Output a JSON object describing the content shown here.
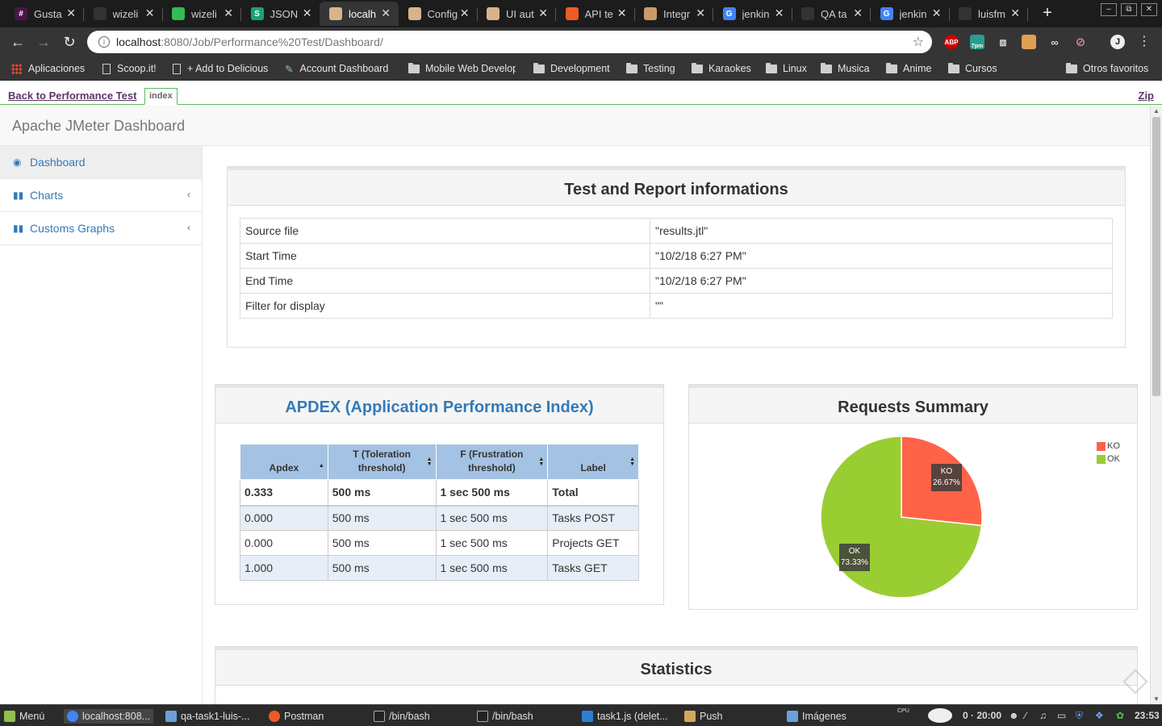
{
  "browser": {
    "tabs": [
      {
        "label": "Gusta",
        "favicon_color": "#4a154b",
        "favicon_glyph": "#"
      },
      {
        "label": "wizeli",
        "favicon_color": "#333333",
        "favicon_glyph": ""
      },
      {
        "label": "wizeli",
        "favicon_color": "#3b5",
        "favicon_glyph": ""
      },
      {
        "label": "JSON S",
        "favicon_color": "#1ca36e",
        "favicon_glyph": "S"
      },
      {
        "label": "localh",
        "favicon_color": "#d9b38c",
        "favicon_glyph": ""
      },
      {
        "label": "Config",
        "favicon_color": "#d9b38c",
        "favicon_glyph": ""
      },
      {
        "label": "UI aut",
        "favicon_color": "#d9b38c",
        "favicon_glyph": ""
      },
      {
        "label": "API te",
        "favicon_color": "#ef5b25",
        "favicon_glyph": ""
      },
      {
        "label": "Integr",
        "favicon_color": "#c96",
        "favicon_glyph": ""
      },
      {
        "label": "jenkin",
        "favicon_color": "#4285f4",
        "favicon_glyph": "G"
      },
      {
        "label": "QA ta",
        "favicon_color": "#333333",
        "favicon_glyph": ""
      },
      {
        "label": "jenkin",
        "favicon_color": "#4285f4",
        "favicon_glyph": "G"
      },
      {
        "label": "luisfm",
        "favicon_color": "#333333",
        "favicon_glyph": ""
      }
    ],
    "active_tab_index": 4,
    "url_host": "localhost",
    "url_path": ":8080/Job/Performance%20Test/Dashboard/",
    "extensions": [
      "ABP",
      "7pm"
    ],
    "bookmarks": [
      {
        "label": "Aplicaciones",
        "icon": "apps-grid-icon"
      },
      {
        "label": "Scoop.it!",
        "icon": "page-icon"
      },
      {
        "label": "+ Add to Delicious",
        "icon": "page-icon"
      },
      {
        "label": "Account Dashboard",
        "icon": "dashboard-icon"
      },
      {
        "label": "Mobile Web Develop",
        "icon": "folder-icon"
      },
      {
        "label": "Development",
        "icon": "folder-icon"
      },
      {
        "label": "Testing",
        "icon": "folder-icon"
      },
      {
        "label": "Karaokes",
        "icon": "folder-icon"
      },
      {
        "label": "Linux",
        "icon": "folder-icon"
      },
      {
        "label": "Musica",
        "icon": "folder-icon"
      },
      {
        "label": "Anime",
        "icon": "folder-icon"
      },
      {
        "label": "Cursos",
        "icon": "folder-icon"
      },
      {
        "label": "Otros favoritos",
        "icon": "folder-icon"
      }
    ]
  },
  "jenkins": {
    "back_label": "Back to Performance Test",
    "index_tab": "index",
    "zip_label": "Zip"
  },
  "dashboard": {
    "brand": "Apache JMeter Dashboard",
    "sidebar": [
      {
        "label": "Dashboard",
        "icon": "dashboard-icon",
        "active": true
      },
      {
        "label": "Charts",
        "icon": "bar-chart-icon",
        "active": false
      },
      {
        "label": "Customs Graphs",
        "icon": "bar-chart-icon",
        "active": false
      }
    ],
    "info_panel": {
      "title": "Test and Report informations",
      "rows": [
        {
          "key": "Source file",
          "value": "\"results.jtl\""
        },
        {
          "key": "Start Time",
          "value": "\"10/2/18 6:27 PM\""
        },
        {
          "key": "End Time",
          "value": "\"10/2/18 6:27 PM\""
        },
        {
          "key": "Filter for display",
          "value": "\"\""
        }
      ]
    },
    "apdex_panel": {
      "title": "APDEX (Application Performance Index)",
      "headers": [
        "Apdex",
        "T (Toleration threshold)",
        "F (Frustration threshold)",
        "Label"
      ],
      "header_lines": [
        [
          "Apdex"
        ],
        [
          "T (Toleration",
          "threshold)"
        ],
        [
          "F (Frustration",
          "threshold)"
        ],
        [
          "Label"
        ]
      ],
      "total": [
        "0.333",
        "500 ms",
        "1 sec 500 ms",
        "Total"
      ],
      "rows": [
        [
          "0.000",
          "500 ms",
          "1 sec 500 ms",
          "Tasks POST"
        ],
        [
          "0.000",
          "500 ms",
          "1 sec 500 ms",
          "Projects GET"
        ],
        [
          "1.000",
          "500 ms",
          "1 sec 500 ms",
          "Tasks GET"
        ]
      ]
    },
    "requests_panel": {
      "title": "Requests Summary"
    },
    "statistics_title": "Statistics"
  },
  "chart_data": {
    "type": "pie",
    "title": "Requests Summary",
    "categories": [
      "KO",
      "OK"
    ],
    "values": [
      26.67,
      73.33
    ],
    "data_labels": [
      "26.67%",
      "73.33%"
    ],
    "colors": [
      "#ff6347",
      "#9acd32"
    ],
    "legend": "top-right"
  },
  "taskbar": {
    "menu_label": "Menú",
    "items": [
      {
        "label": "localhost:808...",
        "icon": "chrome-icon",
        "active": true
      },
      {
        "label": "qa-task1-luis-...",
        "icon": "folder-icon",
        "active": false
      },
      {
        "label": "Postman",
        "icon": "postman-icon",
        "active": false
      },
      {
        "label": "/bin/bash",
        "icon": "terminal-icon",
        "active": false
      },
      {
        "label": "/bin/bash",
        "icon": "terminal-icon",
        "active": false
      },
      {
        "label": "task1.js (delet...",
        "icon": "vscode-icon",
        "active": false
      },
      {
        "label": "Push",
        "icon": "hand-icon",
        "active": false
      },
      {
        "label": "Imágenes",
        "icon": "folder-icon",
        "active": false
      }
    ],
    "cpu_label": "CPU",
    "weather": "0 · 20:00",
    "clock": "23:53"
  }
}
